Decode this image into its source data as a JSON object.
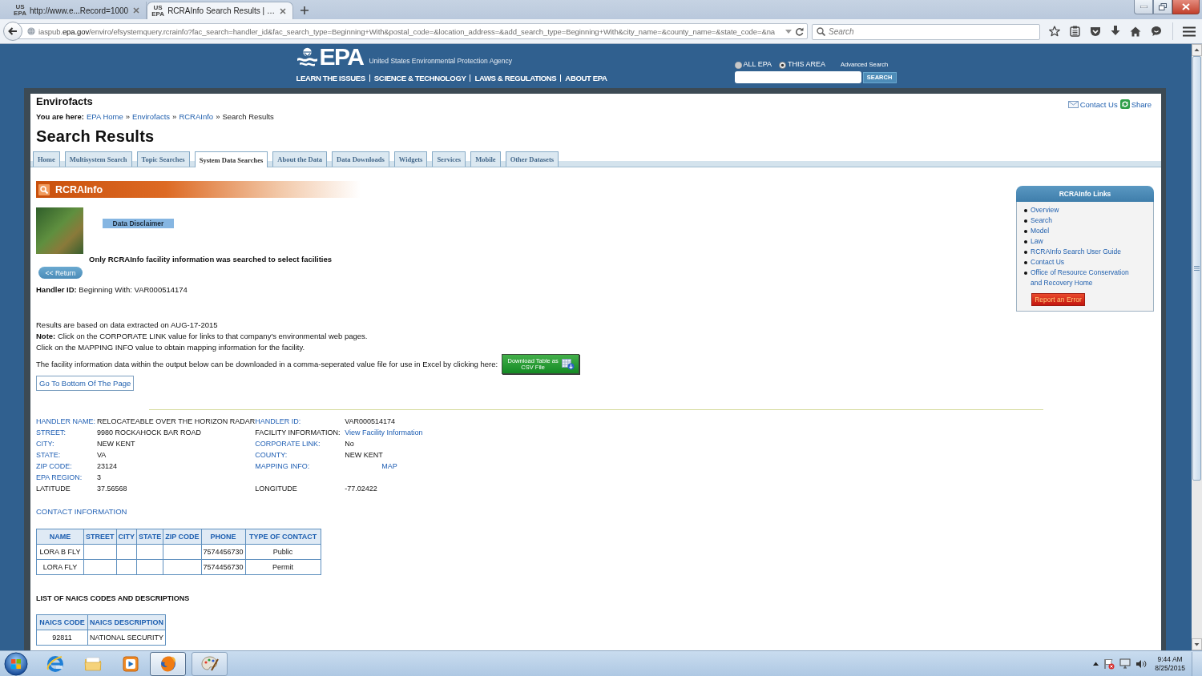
{
  "browser": {
    "tabs": [
      {
        "favicon": "US EPA",
        "title": "http://www.e...Record=1000",
        "selected": false
      },
      {
        "favicon": "US EPA",
        "title": "RCRAInfo Search Results | …",
        "selected": true
      }
    ],
    "address": [
      {
        "kind": "dim",
        "text": "iaspub."
      },
      {
        "kind": "domain",
        "text": "epa.gov"
      },
      {
        "kind": "dim",
        "text": "/enviro/efsystemquery.rcrainfo?fac_search=handler_id&fac_search_type=Beginning+With&postal_code=&location_address=&add_search_type=Beginning+With&city_name=&county_name=&state_code=&na"
      }
    ],
    "search": {
      "placeholder": "Search"
    }
  },
  "header": {
    "logo": "EPA",
    "agency": "United States Environmental Protection Agency",
    "nav": [
      "LEARN THE ISSUES",
      "SCIENCE & TECHNOLOGY",
      "LAWS & REGULATIONS",
      "ABOUT EPA"
    ],
    "scope": [
      {
        "label": "ALL EPA",
        "selected": false
      },
      {
        "label": "THIS AREA",
        "selected": true
      }
    ],
    "advanced": "Advanced Search",
    "search_button": "SEARCH"
  },
  "page": {
    "site": "Envirofacts",
    "utility_links": [
      {
        "kind": "mail",
        "label": "Contact Us"
      },
      {
        "kind": "share",
        "label": "Share"
      }
    ],
    "breadcrumb": {
      "prefix": "You are here:",
      "parts": [
        {
          "kind": "link",
          "text": "EPA Home"
        },
        {
          "kind": "separator",
          "text": "»"
        },
        {
          "kind": "link",
          "text": "Envirofacts"
        },
        {
          "kind": "separator",
          "text": "»"
        },
        {
          "kind": "link",
          "text": "RCRAInfo"
        },
        {
          "kind": "separator",
          "text": "»"
        },
        {
          "kind": "current",
          "text": "Search Results"
        }
      ]
    },
    "title": "Search Results",
    "tabs": [
      {
        "label": "Home",
        "selected": false
      },
      {
        "label": "Multisystem Search",
        "selected": false
      },
      {
        "label": "Topic Searches",
        "selected": false
      },
      {
        "label": "System Data Searches",
        "selected": true
      },
      {
        "label": "About the Data",
        "selected": false
      },
      {
        "label": "Data Downloads",
        "selected": false
      },
      {
        "label": "Widgets",
        "selected": false
      },
      {
        "label": "Services",
        "selected": false
      },
      {
        "label": "Mobile",
        "selected": false
      },
      {
        "label": "Other Datasets",
        "selected": false
      }
    ],
    "banner": "RCRAInfo",
    "disclaimer_button": "Data Disclaimer",
    "scope_note": "Only RCRAInfo facility information was searched to select facilities",
    "return_button": "<< Return",
    "criteria": "**Handler ID:** Beginning With: VAR000514174",
    "notes": [
      "Results are based on data extracted on AUG-17-2015",
      "**Note:** Click on the CORPORATE LINK value for links to that company's environmental web pages.",
      "Click on the MAPPING INFO value to obtain mapping information for the facility."
    ],
    "download": {
      "text": "The facility information data within the output below can be downloaded in a comma-seperated value file for use in Excel by clicking here:",
      "button": "Download Table as CSV File"
    },
    "bottom_link": "Go To Bottom Of The Page",
    "facility": [
      [
        {
          "label": {
            "kind": "link",
            "text": "HANDLER NAME:"
          },
          "value": {
            "kind": "text",
            "text": "RELOCATEABLE OVER THE HORIZON RADAR"
          }
        },
        {
          "label": {
            "kind": "link",
            "text": "HANDLER ID:"
          },
          "value": {
            "kind": "text",
            "text": "VAR000514174"
          }
        }
      ],
      [
        {
          "label": {
            "kind": "link",
            "text": "STREET:"
          },
          "value": {
            "kind": "text",
            "text": "9980 ROCKAHOCK BAR ROAD"
          }
        },
        {
          "label": {
            "kind": "text",
            "text": "FACILITY INFORMATION:"
          },
          "value": {
            "kind": "link",
            "text": "View Facility Information"
          }
        }
      ],
      [
        {
          "label": {
            "kind": "link",
            "text": "CITY:"
          },
          "value": {
            "kind": "text",
            "text": "NEW KENT"
          }
        },
        {
          "label": {
            "kind": "link",
            "text": "CORPORATE LINK:"
          },
          "value": {
            "kind": "text",
            "text": "No"
          }
        }
      ],
      [
        {
          "label": {
            "kind": "link",
            "text": "STATE:"
          },
          "value": {
            "kind": "text",
            "text": "VA"
          }
        },
        {
          "label": {
            "kind": "link",
            "text": "COUNTY:"
          },
          "value": {
            "kind": "text",
            "text": "NEW KENT"
          }
        }
      ],
      [
        {
          "label": {
            "kind": "link",
            "text": "ZIP CODE:"
          },
          "value": {
            "kind": "text",
            "text": "23124"
          }
        },
        {
          "label": {
            "kind": "link",
            "text": "MAPPING INFO:"
          },
          "value": {
            "kind": "map",
            "text": "MAP"
          }
        }
      ],
      [
        {
          "label": {
            "kind": "link",
            "text": "EPA REGION:"
          },
          "value": {
            "kind": "text",
            "text": "3"
          }
        }
      ],
      [
        {
          "label": {
            "kind": "text",
            "text": "LATITUDE"
          },
          "value": {
            "kind": "text",
            "text": "37.56568"
          }
        },
        {
          "label": {
            "kind": "text",
            "text": "LONGITUDE"
          },
          "value": {
            "kind": "text",
            "text": "-77.02422"
          }
        }
      ]
    ],
    "contact_heading": "CONTACT INFORMATION",
    "contacts": {
      "columns": [
        "NAME",
        "STREET",
        "CITY",
        "STATE",
        "ZIP CODE",
        "PHONE",
        "TYPE OF CONTACT"
      ],
      "rows": [
        [
          "LORA B FLY",
          null,
          null,
          null,
          null,
          "7574456730",
          "Public"
        ],
        [
          "LORA FLY",
          null,
          null,
          null,
          null,
          "7574456730",
          "Permit"
        ]
      ]
    },
    "naics_heading": "LIST OF NAICS CODES AND DESCRIPTIONS",
    "naics": {
      "columns": [
        "NAICS CODE",
        "NAICS DESCRIPTION"
      ],
      "rows": [
        [
          "92811",
          "NATIONAL SECURITY"
        ]
      ]
    }
  },
  "links_panel": {
    "title": "RCRAInfo Links",
    "items": [
      "Overview",
      "Search",
      "Model",
      "Law",
      "RCRAInfo Search User Guide",
      "Contact Us",
      "Office of Resource Conservation and Recovery Home"
    ],
    "report_button": "Report an Error"
  },
  "taskbar": {
    "apps": [
      {
        "kind": "ie",
        "open": false,
        "selected": false
      },
      {
        "kind": "folder",
        "open": false,
        "selected": false
      },
      {
        "kind": "media",
        "open": false,
        "selected": false
      },
      {
        "kind": "firefox",
        "open": true,
        "selected": true
      },
      {
        "kind": "paint",
        "open": true,
        "selected": false
      }
    ],
    "time": "9:44 AM",
    "date": "8/25/2015"
  }
}
